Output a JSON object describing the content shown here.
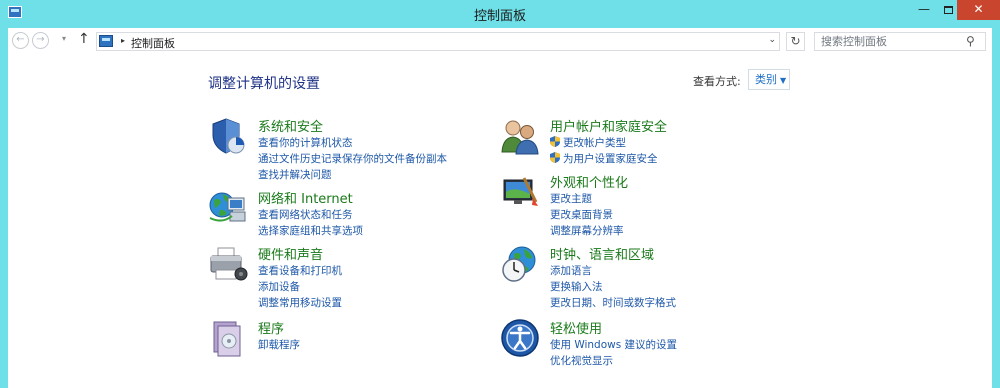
{
  "window": {
    "title": "控制面板",
    "close_glyph": "✕",
    "min_glyph": "—"
  },
  "nav": {
    "back_glyph": "←",
    "forward_glyph": "→",
    "recent_glyph": "▾",
    "up_glyph": "↑",
    "path_sep": "▸",
    "path": "控制面板",
    "refresh_glyph": "↻",
    "dropdown_glyph": "⌄"
  },
  "search": {
    "placeholder": "搜索控制面板",
    "icon_glyph": "⚲"
  },
  "main": {
    "title": "调整计算机的设置",
    "view_by_label": "查看方式:",
    "view_by_value": "类别",
    "caret": "▼"
  },
  "categories": [
    {
      "title": "系统和安全",
      "icon": "shield-system-icon",
      "links": [
        "查看你的计算机状态",
        "通过文件历史记录保存你的文件备份副本",
        "查找并解决问题"
      ]
    },
    {
      "title": "网络和 Internet",
      "icon": "network-globe-icon",
      "links": [
        "查看网络状态和任务",
        "选择家庭组和共享选项"
      ]
    },
    {
      "title": "硬件和声音",
      "icon": "printer-icon",
      "links": [
        "查看设备和打印机",
        "添加设备",
        "调整常用移动设置"
      ]
    },
    {
      "title": "程序",
      "icon": "programs-icon",
      "links": [
        "卸载程序"
      ]
    },
    {
      "title": "用户帐户和家庭安全",
      "icon": "users-icon",
      "links": [
        "更改帐户类型",
        "为用户设置家庭安全"
      ]
    },
    {
      "title": "外观和个性化",
      "icon": "display-brush-icon",
      "links": [
        "更改主题",
        "更改桌面背景",
        "调整屏幕分辨率"
      ]
    },
    {
      "title": "时钟、语言和区域",
      "icon": "clock-globe-icon",
      "links": [
        "添加语言",
        "更换输入法",
        "更改日期、时间或数字格式"
      ]
    },
    {
      "title": "轻松使用",
      "icon": "ease-of-access-icon",
      "links": [
        "使用 Windows 建议的设置",
        "优化视觉显示"
      ]
    }
  ],
  "colors": {
    "titlebar": "#6fe0e8",
    "category_title": "#1a7a1a",
    "link": "#1e58a8",
    "page_title": "#1e3287"
  }
}
